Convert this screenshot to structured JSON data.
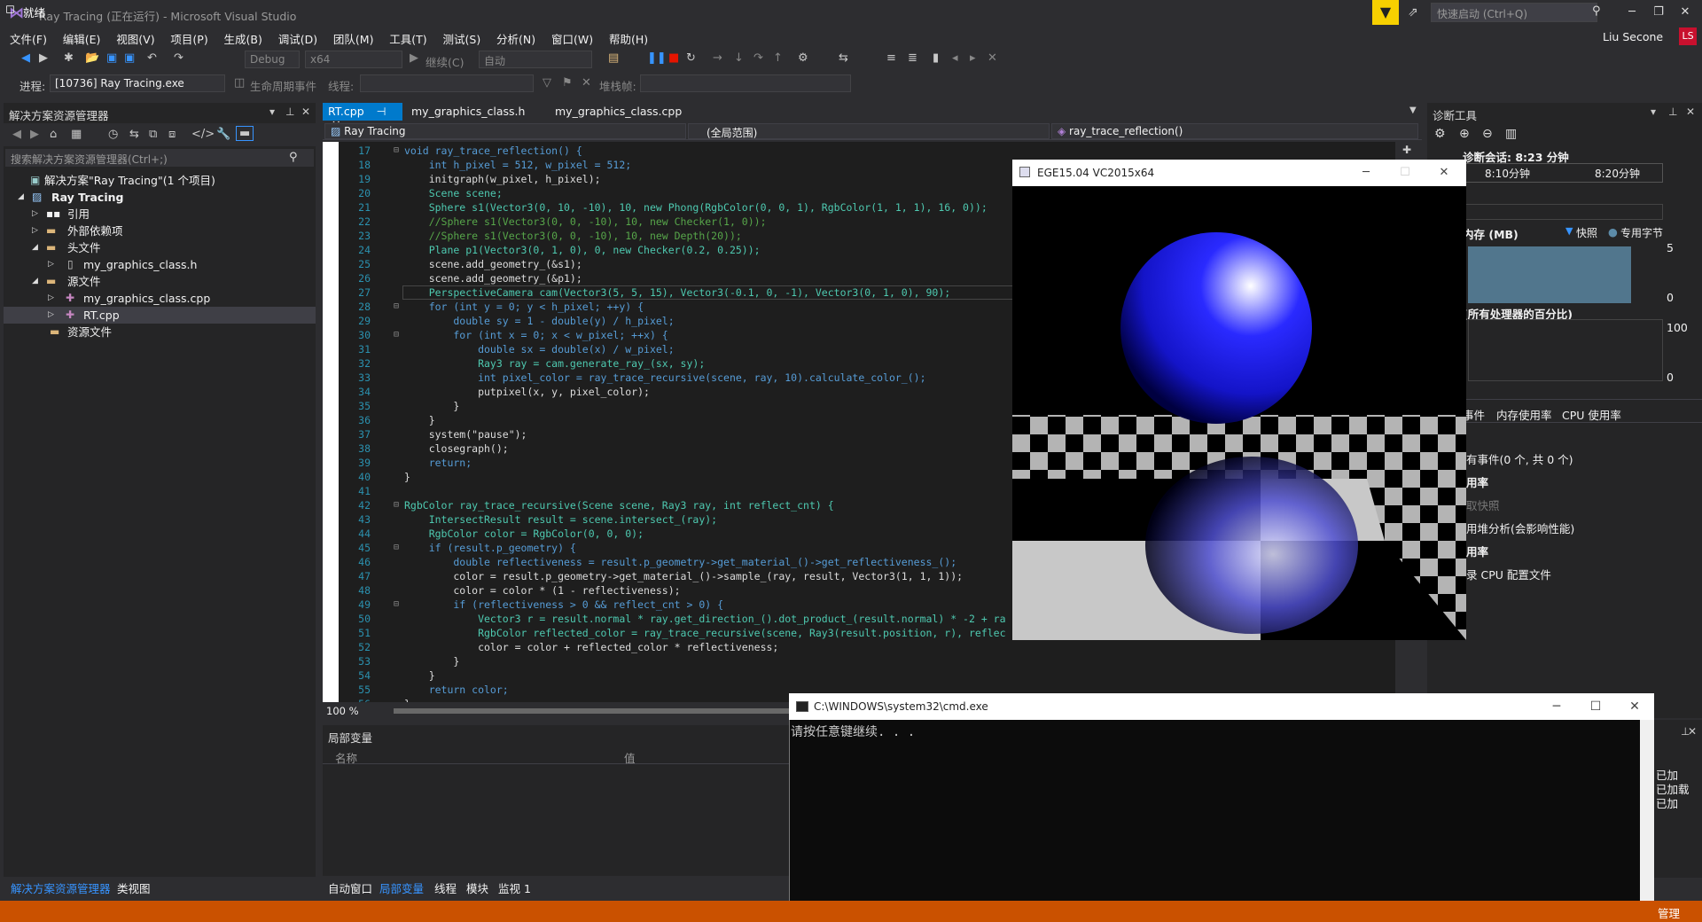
{
  "window": {
    "title": "Ray Tracing (正在运行) - Microsoft Visual Studio",
    "quick_launch_placeholder": "快速启动 (Ctrl+Q)",
    "user_name": "Liu Secone",
    "user_initials": "LS"
  },
  "menu": [
    "文件(F)",
    "编辑(E)",
    "视图(V)",
    "项目(P)",
    "生成(B)",
    "调试(D)",
    "团队(M)",
    "工具(T)",
    "测试(S)",
    "分析(N)",
    "窗口(W)",
    "帮助(H)"
  ],
  "toolbar": {
    "config": "Debug",
    "platform": "x64",
    "continue_label": "继续(C)",
    "auto_label": "自动",
    "process_label": "进程:",
    "process_value": "[10736] Ray Tracing.exe",
    "lifecycle_label": "生命周期事件",
    "thread_label": "线程:",
    "stack_label": "堆栈帧:"
  },
  "solution_explorer": {
    "title": "解决方案资源管理器",
    "search_placeholder": "搜索解决方案资源管理器(Ctrl+;)",
    "items": [
      {
        "label": "解决方案\"Ray Tracing\"(1 个项目)"
      },
      {
        "label": "Ray Tracing"
      },
      {
        "label": "引用"
      },
      {
        "label": "外部依赖项"
      },
      {
        "label": "头文件"
      },
      {
        "label": "my_graphics_class.h"
      },
      {
        "label": "源文件"
      },
      {
        "label": "my_graphics_class.cpp"
      },
      {
        "label": "RT.cpp"
      },
      {
        "label": "资源文件"
      }
    ],
    "tabs": [
      "解决方案资源管理器",
      "类视图"
    ]
  },
  "editor": {
    "tabs": [
      "RT.cpp",
      "my_graphics_class.h",
      "my_graphics_class.cpp"
    ],
    "nav_project": "Ray Tracing",
    "nav_scope": "(全局范围)",
    "nav_function": "ray_trace_reflection()",
    "zoom": "100 %",
    "lines": [
      {
        "n": "17",
        "t": "void ray_trace_reflection() {"
      },
      {
        "n": "18",
        "t": "    int h_pixel = 512, w_pixel = 512;"
      },
      {
        "n": "19",
        "t": "    initgraph(w_pixel, h_pixel);"
      },
      {
        "n": "20",
        "t": "    Scene scene;"
      },
      {
        "n": "21",
        "t": "    Sphere s1(Vector3(0, 10, -10), 10, new Phong(RgbColor(0, 0, 1), RgbColor(1, 1, 1), 16, 0));"
      },
      {
        "n": "22",
        "t": "    //Sphere s1(Vector3(0, 0, -10), 10, new Checker(1, 0));"
      },
      {
        "n": "23",
        "t": "    //Sphere s1(Vector3(0, 0, -10), 10, new Depth(20));"
      },
      {
        "n": "24",
        "t": "    Plane p1(Vector3(0, 1, 0), 0, new Checker(0.2, 0.25));"
      },
      {
        "n": "25",
        "t": "    scene.add_geometry_(&s1);"
      },
      {
        "n": "26",
        "t": "    scene.add_geometry_(&p1);"
      },
      {
        "n": "27",
        "t": "    PerspectiveCamera cam(Vector3(5, 5, 15), Vector3(-0.1, 0, -1), Vector3(0, 1, 0), 90);"
      },
      {
        "n": "28",
        "t": "    for (int y = 0; y < h_pixel; ++y) {"
      },
      {
        "n": "29",
        "t": "        double sy = 1 - double(y) / h_pixel;"
      },
      {
        "n": "30",
        "t": "        for (int x = 0; x < w_pixel; ++x) {"
      },
      {
        "n": "31",
        "t": "            double sx = double(x) / w_pixel;"
      },
      {
        "n": "32",
        "t": "            Ray3 ray = cam.generate_ray_(sx, sy);"
      },
      {
        "n": "33",
        "t": "            int pixel_color = ray_trace_recursive(scene, ray, 10).calculate_color_();"
      },
      {
        "n": "34",
        "t": "            putpixel(x, y, pixel_color);"
      },
      {
        "n": "35",
        "t": "        }"
      },
      {
        "n": "36",
        "t": "    }"
      },
      {
        "n": "37",
        "t": "    system(\"pause\");"
      },
      {
        "n": "38",
        "t": "    closegraph();"
      },
      {
        "n": "39",
        "t": "    return;"
      },
      {
        "n": "40",
        "t": "}"
      },
      {
        "n": "41",
        "t": ""
      },
      {
        "n": "42",
        "t": "RgbColor ray_trace_recursive(Scene scene, Ray3 ray, int reflect_cnt) {"
      },
      {
        "n": "43",
        "t": "    IntersectResult result = scene.intersect_(ray);"
      },
      {
        "n": "44",
        "t": "    RgbColor color = RgbColor(0, 0, 0);"
      },
      {
        "n": "45",
        "t": "    if (result.p_geometry) {"
      },
      {
        "n": "46",
        "t": "        double reflectiveness = result.p_geometry->get_material_()->get_reflectiveness_();"
      },
      {
        "n": "47",
        "t": "        color = result.p_geometry->get_material_()->sample_(ray, result, Vector3(1, 1, 1));"
      },
      {
        "n": "48",
        "t": "        color = color * (1 - reflectiveness);"
      },
      {
        "n": "49",
        "t": "        if (reflectiveness > 0 && reflect_cnt > 0) {"
      },
      {
        "n": "50",
        "t": "            Vector3 r = result.normal * ray.get_direction_().dot_product_(result.normal) * -2 + ra"
      },
      {
        "n": "51",
        "t": "            RgbColor reflected_color = ray_trace_recursive(scene, Ray3(result.position, r), reflec"
      },
      {
        "n": "52",
        "t": "            color = color + reflected_color * reflectiveness;"
      },
      {
        "n": "53",
        "t": "        }"
      },
      {
        "n": "54",
        "t": "    }"
      },
      {
        "n": "55",
        "t": "    return color;"
      },
      {
        "n": "56",
        "t": "}"
      }
    ]
  },
  "locals": {
    "title": "局部变量",
    "col_name": "名称",
    "col_value": "值",
    "tabs": [
      "自动窗口",
      "局部变量",
      "线程",
      "模块",
      "监视 1"
    ]
  },
  "diagnostics": {
    "title": "诊断工具",
    "session": "诊断会话: 8:23 分钟",
    "time1": "8:10分钟",
    "time2": "8:20分钟",
    "memory_label": "内存 (MB)",
    "snapshot_legend": "快照",
    "private_legend": "专用字节",
    "mem_max": "5",
    "mem_min": "0",
    "cpu_label": "(所有处理器的百分比)",
    "cpu_max": "100",
    "cpu_min": "0",
    "tabs": [
      "事件",
      "内存使用率",
      "CPU 使用率"
    ],
    "events": "有事件(0 个, 共 0 个)",
    "mem_usage": "用率",
    "take_snapshot": "取快照",
    "heap_analysis": "用堆分析(会影响性能)",
    "cpu_usage": "用率",
    "cpu_profile": "录 CPU 配置文件"
  },
  "ege_window": {
    "title": "EGE15.04 VC2015x64"
  },
  "cmd_window": {
    "title": "C:\\WINDOWS\\system32\\cmd.exe",
    "text": "请按任意键继续. . ."
  },
  "right_output": {
    "lines": [
      "已加",
      "已加载",
      "已加"
    ],
    "manage": "管理"
  },
  "status": {
    "text": "就绪"
  }
}
